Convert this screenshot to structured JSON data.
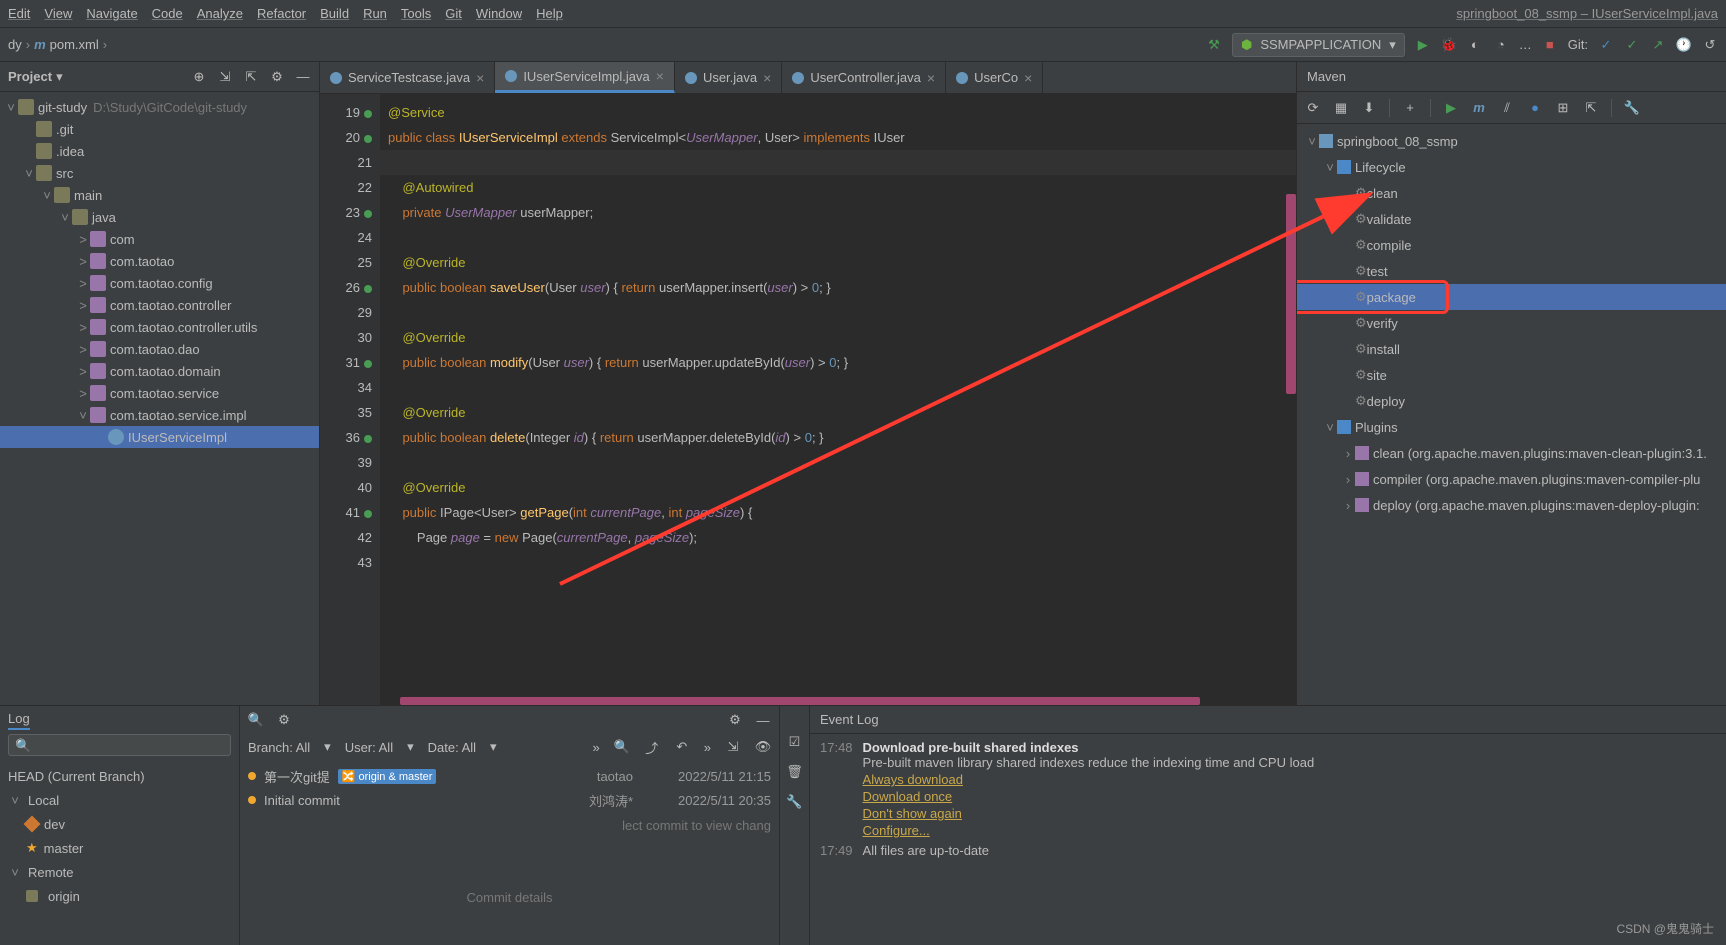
{
  "menu": {
    "items": [
      "Edit",
      "View",
      "Navigate",
      "Code",
      "Analyze",
      "Refactor",
      "Build",
      "Run",
      "Tools",
      "Git",
      "Window",
      "Help"
    ],
    "window_title": "springboot_08_ssmp – IUserServiceImpl.java"
  },
  "breadcrumb": {
    "items": [
      "dy",
      "pom.xml"
    ]
  },
  "toolbar": {
    "run_config": "SSMPAPPLICATION",
    "git_label": "Git:"
  },
  "project": {
    "label": "Project",
    "root": "git-study",
    "root_loc": "D:\\Study\\GitCode\\git-study",
    "nodes": [
      {
        "d": 0,
        "e": true,
        "k": "folder",
        "l": "git-study",
        "loc": "D:\\Study\\GitCode\\git-study"
      },
      {
        "d": 1,
        "e": false,
        "k": "folder",
        "l": ".git"
      },
      {
        "d": 1,
        "e": false,
        "k": "folder",
        "l": ".idea"
      },
      {
        "d": 1,
        "e": true,
        "k": "folder",
        "l": "src"
      },
      {
        "d": 2,
        "e": true,
        "k": "folder",
        "l": "main"
      },
      {
        "d": 3,
        "e": true,
        "k": "folder",
        "l": "java"
      },
      {
        "d": 4,
        "e": false,
        "k": "pkg",
        "l": "com",
        "tw": ">"
      },
      {
        "d": 4,
        "e": false,
        "k": "pkg",
        "l": "com.taotao",
        "tw": ">"
      },
      {
        "d": 4,
        "e": false,
        "k": "pkg",
        "l": "com.taotao.config",
        "tw": ">"
      },
      {
        "d": 4,
        "e": false,
        "k": "pkg",
        "l": "com.taotao.controller",
        "tw": ">"
      },
      {
        "d": 4,
        "e": false,
        "k": "pkg",
        "l": "com.taotao.controller.utils",
        "tw": ">"
      },
      {
        "d": 4,
        "e": false,
        "k": "pkg",
        "l": "com.taotao.dao",
        "tw": ">"
      },
      {
        "d": 4,
        "e": false,
        "k": "pkg",
        "l": "com.taotao.domain",
        "tw": ">"
      },
      {
        "d": 4,
        "e": false,
        "k": "pkg",
        "l": "com.taotao.service",
        "tw": ">"
      },
      {
        "d": 4,
        "e": true,
        "k": "pkg",
        "l": "com.taotao.service.impl"
      },
      {
        "d": 5,
        "e": false,
        "k": "cls",
        "l": "IUserServiceImpl",
        "sel": true
      }
    ]
  },
  "tabs": [
    {
      "l": "ServiceTestcase.java",
      "a": false
    },
    {
      "l": "IUserServiceImpl.java",
      "a": true
    },
    {
      "l": "User.java",
      "a": false
    },
    {
      "l": "UserController.java",
      "a": false
    },
    {
      "l": "UserCo",
      "a": false
    }
  ],
  "code": {
    "start": 19,
    "lines": [
      {
        "n": 19,
        "m": 1,
        "h": "<span class='ann'>@Service</span>"
      },
      {
        "n": 20,
        "m": 1,
        "h": "<span class='kw'>public class</span> <span class='type'>IUserServiceImpl</span> <span class='kw'>extends</span> ServiceImpl&lt;<span class='id'>UserMapper</span>, User&gt; <span class='kw'>implements</span> IUser"
      },
      {
        "n": 21,
        "hl": true,
        "h": ""
      },
      {
        "n": 22,
        "h": "    <span class='ann'>@Autowired</span>"
      },
      {
        "n": 23,
        "m": 1,
        "h": "    <span class='kw'>private</span> <span class='id'>UserMapper</span> userMapper;"
      },
      {
        "n": 24,
        "h": ""
      },
      {
        "n": 25,
        "h": "    <span class='ann'>@Override</span>"
      },
      {
        "n": 26,
        "m": 2,
        "h": "    <span class='kw'>public boolean</span> <span class='fn'>saveUser</span>(User <span class='id'>user</span>) { <span class='kw'>return</span> userMapper.insert(<span class='id'>user</span>) &gt; <span class='num'>0</span>; }"
      },
      {
        "n": 29,
        "h": ""
      },
      {
        "n": 30,
        "h": "    <span class='ann'>@Override</span>"
      },
      {
        "n": 31,
        "m": 2,
        "h": "    <span class='kw'>public boolean</span> <span class='fn'>modify</span>(User <span class='id'>user</span>) { <span class='kw'>return</span> userMapper.updateById(<span class='id'>user</span>) &gt; <span class='num'>0</span>; }"
      },
      {
        "n": 34,
        "h": ""
      },
      {
        "n": 35,
        "h": "    <span class='ann'>@Override</span>"
      },
      {
        "n": 36,
        "m": 2,
        "h": "    <span class='kw'>public boolean</span> <span class='fn'>delete</span>(Integer <span class='id'>id</span>) { <span class='kw'>return</span> userMapper.deleteById(<span class='id'>id</span>) &gt; <span class='num'>0</span>; }"
      },
      {
        "n": 39,
        "h": ""
      },
      {
        "n": 40,
        "h": "    <span class='ann'>@Override</span>"
      },
      {
        "n": 41,
        "m": 2,
        "h": "    <span class='kw'>public</span> IPage&lt;User&gt; <span class='fn'>getPage</span>(<span class='kw'>int</span> <span class='id'>currentPage</span>, <span class='kw'>int</span> <span class='id'>pageSize</span>) {"
      },
      {
        "n": 42,
        "h": "        Page <span class='id'>page</span> = <span class='kw'>new</span> Page(<span class='id'>currentPage</span>, <span class='id'>pageSize</span>);"
      },
      {
        "n": 43,
        "h": ""
      }
    ]
  },
  "maven": {
    "title": "Maven",
    "project": "springboot_08_ssmp",
    "lifecycle": {
      "label": "Lifecycle",
      "items": [
        "clean",
        "validate",
        "compile",
        "test",
        "package",
        "verify",
        "install",
        "site",
        "deploy"
      ],
      "selected": "package"
    },
    "plugins": {
      "label": "Plugins",
      "items": [
        "clean (org.apache.maven.plugins:maven-clean-plugin:3.1.",
        "compiler (org.apache.maven.plugins:maven-compiler-plu",
        "deploy (org.apache.maven.plugins:maven-deploy-plugin:"
      ]
    }
  },
  "log": {
    "tab": "Log",
    "head": "HEAD (Current Branch)",
    "groups": [
      {
        "l": "Local",
        "open": true,
        "items": [
          {
            "ic": "tag",
            "l": "dev"
          },
          {
            "ic": "star",
            "l": "master"
          }
        ]
      },
      {
        "l": "Remote",
        "open": true,
        "items": [
          {
            "ic": "folder",
            "l": "origin"
          }
        ]
      }
    ]
  },
  "commits": {
    "filters": {
      "branch": "Branch: All",
      "user": "User: All",
      "date": "Date: All"
    },
    "rows": [
      {
        "dot": true,
        "badge": "origin & master",
        "msg": "第一次git提",
        "auth": "taotao",
        "date": "2022/5/11 21:15"
      },
      {
        "dot": true,
        "msg": "Initial commit",
        "auth": "刘鸿涛*",
        "date": "2022/5/11 20:35"
      }
    ],
    "hint": "lect commit to view chang",
    "detail_title": "Commit details"
  },
  "eventlog": {
    "title": "Event Log",
    "rows": [
      {
        "ts": "17:48",
        "head": "Download pre-built shared indexes",
        "body": "Pre-built maven library shared indexes reduce the indexing time and CPU load",
        "links": [
          "Always download",
          "Download once",
          "Don't show again",
          "Configure..."
        ]
      },
      {
        "ts": "17:49",
        "body": "All files are up-to-date"
      }
    ]
  },
  "watermark": "CSDN @鬼鬼骑士"
}
